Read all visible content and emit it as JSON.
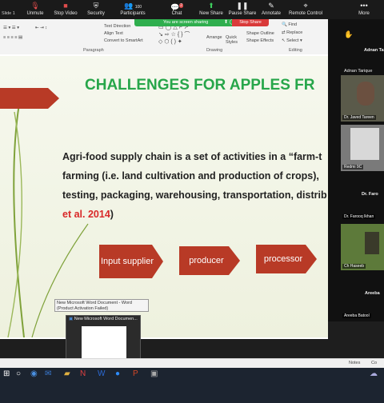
{
  "zoom_toolbar": {
    "left_label": "Slide 1",
    "buttons": [
      {
        "label": "Unmute"
      },
      {
        "label": "Stop Video"
      },
      {
        "label": "Security"
      },
      {
        "label": "Participants",
        "count": "100"
      },
      {
        "label": "Chat",
        "badge": "2"
      },
      {
        "label": "New Share"
      },
      {
        "label": "Pause Share"
      },
      {
        "label": "Annotate"
      },
      {
        "label": "Remote Control"
      },
      {
        "label": "More"
      }
    ]
  },
  "share_indicator": {
    "text": "You are screen sharing",
    "stop_label": "Stop Share"
  },
  "ribbon": {
    "items": {
      "text_direction": "Text Direction",
      "align_text": "Align Text",
      "convert_smartart": "Convert to SmartArt",
      "arrange": "Arrange",
      "quick_styles": "Quick Styles",
      "shape_outline": "Shape Outline",
      "shape_effects": "Shape Effects",
      "find": "Find",
      "replace": "Replace",
      "select": "Select"
    },
    "groups": {
      "paragraph": "Paragraph",
      "drawing": "Drawing",
      "editing": "Editing"
    }
  },
  "slide": {
    "title": "CHALLENGES FOR APPLES FR",
    "body_line1": "Agri-food supply chain is a set of activities in a “farm-t",
    "body_line2": "farming (i.e. land cultivation and production of crops),",
    "body_line3": "testing, packaging, warehousing, transportation, distrib",
    "body_citation": "et al. 2014",
    "body_close": ")",
    "flow": [
      "Input supplier",
      "producer",
      "processor"
    ]
  },
  "thumbnail": {
    "tooltip": "New Microsoft Word Document - Word (Product Activation Failed)",
    "title": "New Microsoft Word Documen..."
  },
  "participants": {
    "header1": "Adnan Ta",
    "tiles": [
      {
        "name": "Adnan Tarique"
      },
      {
        "name": "Dr. Javed Tareen"
      },
      {
        "name": "Redmi 9C"
      }
    ],
    "header2": "Dr. Faro",
    "tiles2": [
      {
        "name": "Dr. Farooq Ikhan"
      },
      {
        "name": "Ch Haseeb"
      }
    ],
    "header3": "Areeba",
    "tiles3": [
      {
        "name": "Areeba Batool"
      }
    ]
  },
  "statusbar": {
    "notes": "Notes",
    "comments": "Co"
  },
  "colors": {
    "title_green": "#27a64a",
    "arrow_red": "#b83a26",
    "share_green": "#2fae4e",
    "stop_red": "#d93a3a"
  }
}
